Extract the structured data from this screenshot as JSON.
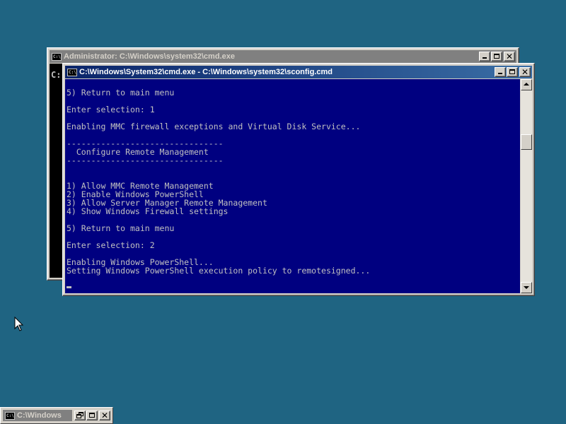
{
  "back_window": {
    "title": "Administrator: C:\\Windows\\system32\\cmd.exe",
    "icon": "cmd-icon",
    "icon_text": "C:\\",
    "prompt": "C:"
  },
  "front_window": {
    "title": "C:\\Windows\\System32\\cmd.exe - C:\\Windows\\system32\\sconfig.cmd",
    "icon": "cmd-icon",
    "icon_text": "C:\\",
    "console_lines": [
      {
        "text": "5) Return to main menu"
      },
      {
        "text": "Enter selection: 1"
      },
      {
        "text": "Enabling MMC firewall exceptions and Virtual Disk Service..."
      },
      {
        "text": "--------------------------------"
      },
      {
        "text": "  Configure Remote Management"
      },
      {
        "text": "--------------------------------"
      },
      {
        "text": "1) Allow MMC Remote Management"
      },
      {
        "text": "2) Enable Windows PowerShell"
      },
      {
        "text": "3) Allow Server Manager Remote Management"
      },
      {
        "text": "4) Show Windows Firewall settings"
      },
      {
        "text": "5) Return to main menu"
      },
      {
        "text": "Enter selection: 2"
      },
      {
        "text": "Enabling Windows PowerShell..."
      },
      {
        "text": "Setting Windows PowerShell execution policy to remotesigned..."
      }
    ]
  },
  "minimized_window": {
    "title": "C:\\Windows",
    "icon": "cmd-icon",
    "icon_text": "C:\\"
  },
  "colors": {
    "desktop": "#1f6482",
    "console_bg": "#000080",
    "console_fg": "#c0c0c0",
    "active_title": "#0a246a",
    "inactive_title": "#808080"
  }
}
